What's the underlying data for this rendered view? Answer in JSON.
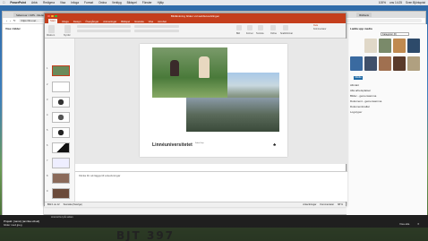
{
  "menubar": {
    "app": "PowerPoint",
    "items": [
      "Arkiv",
      "Redigera",
      "Visa",
      "Infoga",
      "Format",
      "Ordna",
      "Verktyg",
      "Bildspel",
      "Fönster",
      "Hjälp"
    ],
    "status": [
      "100%",
      "ons 14:25",
      "Sven Björkqvist"
    ]
  },
  "browser": {
    "tabs": [
      "Sidansvar i CMS - Medarbetare",
      "Forskningskommunikation",
      "Lnu.se",
      "Bildbank"
    ],
    "url": "https://lnu.se/...",
    "left_title": "Visa i bilder",
    "right_header": "Ladda upp media",
    "right_dropdown": "Kategorier (0)",
    "right_tab": "Media",
    "right_items": [
      "Allmänt",
      "Alla arbetsplatser",
      "Bilder - gemensamma",
      "Dokument - gemensamma",
      "Dokumentmallar",
      "Logotyper"
    ]
  },
  "ppt": {
    "title": "Bildlänkning bilden vid webbutvecklingen",
    "tabs": [
      "Start",
      "Infoga",
      "Design",
      "Övergångar",
      "Animeringar",
      "Bildspel",
      "Granska",
      "Visa",
      "Acrobat"
    ],
    "ribbon": {
      "paste": "Klistra in",
      "new_slide": "Ny bild",
      "labels": [
        "Bild",
        "Former",
        "Textruta",
        "Ordna",
        "Snabbformat",
        "Dela",
        "Kommentarer"
      ]
    },
    "slide_numbers": [
      "1",
      "2",
      "3",
      "4",
      "5",
      "6",
      "7",
      "8",
      "9"
    ],
    "logo": "Linnéuniversitetet",
    "logo_sub": [
      "Kalmar Växjö"
    ],
    "notes_placeholder": "Klicka för att lägga till anteckningar",
    "status_left": "Bild 1 av 12",
    "status_lang": "Svenska (Sverige)",
    "status_right": [
      "Anteckningar",
      "Kommentarer",
      "68 %"
    ]
  },
  "bottombar": {
    "left": "Anmäl fel på sidan",
    "project": "Projekt: [namn] [amrika utbud]",
    "file": "bilder med.jpeg",
    "visa_alla": "Visa alla"
  },
  "plate": "BJT 397",
  "colors": {
    "ppt_accent": "#c43e1c",
    "desktop": "#3d7fbd"
  }
}
